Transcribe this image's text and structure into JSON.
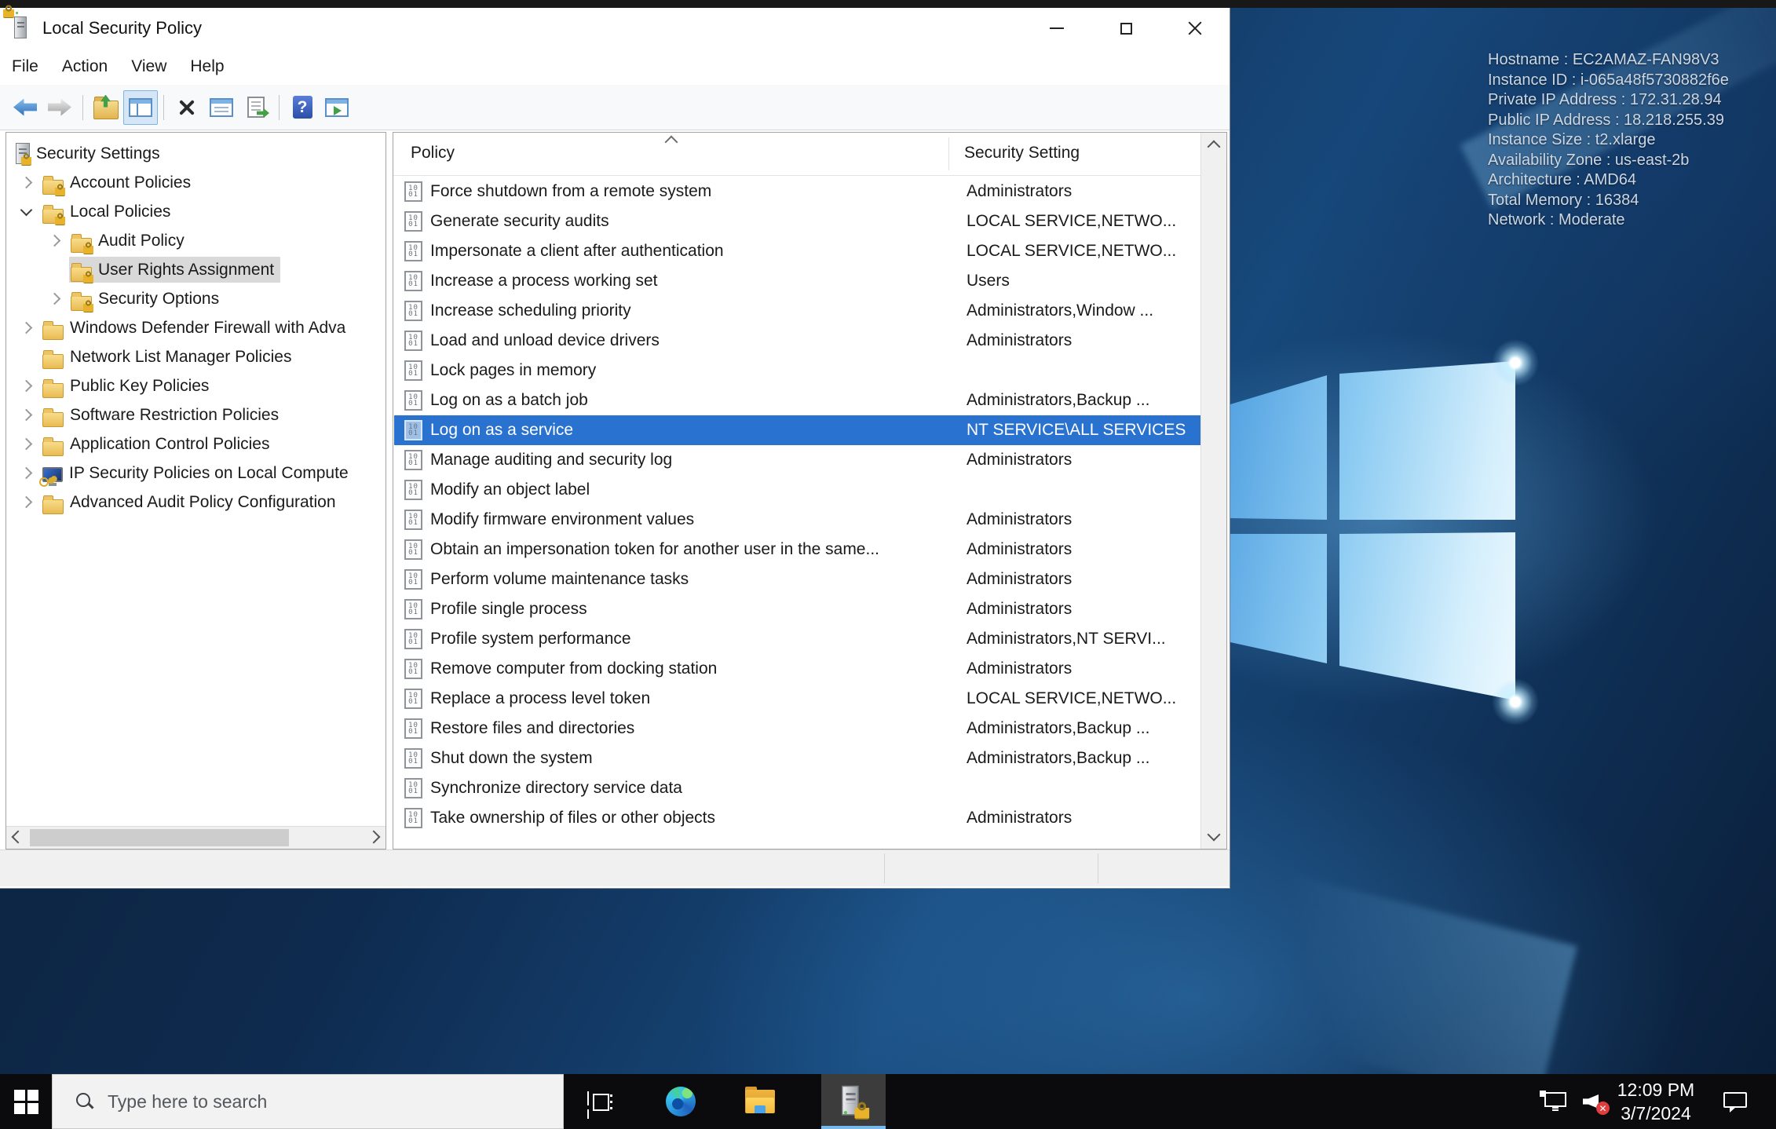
{
  "desktop": {
    "system_info": [
      "Hostname : EC2AMAZ-FAN98V3",
      "Instance ID : i-065a48f5730882f6e",
      "Private IP Address : 172.31.28.94",
      "Public IP Address : 18.218.255.39",
      "Instance Size : t2.xlarge",
      "Availability Zone : us-east-2b",
      "Architecture : AMD64",
      "Total Memory : 16384",
      "Network : Moderate"
    ]
  },
  "window": {
    "title": "Local Security Policy",
    "menu": [
      "File",
      "Action",
      "View",
      "Help"
    ],
    "toolbar_icons": [
      "back-arrow",
      "forward-arrow",
      "up-one-level",
      "show-console-tree",
      "delete",
      "properties",
      "export-list",
      "help",
      "show-action-pane"
    ],
    "tree": {
      "items": [
        {
          "label": "Security Settings",
          "level": 0,
          "expander": "none",
          "icon": "server-lock",
          "selected": false
        },
        {
          "label": "Account Policies",
          "level": 1,
          "expander": "collapsed",
          "icon": "folder-lock",
          "selected": false
        },
        {
          "label": "Local Policies",
          "level": 1,
          "expander": "expanded",
          "icon": "folder-lock",
          "selected": false
        },
        {
          "label": "Audit Policy",
          "level": 2,
          "expander": "collapsed",
          "icon": "folder-lock",
          "selected": false
        },
        {
          "label": "User Rights Assignment",
          "level": 2,
          "expander": "none",
          "icon": "folder-lock",
          "selected": true
        },
        {
          "label": "Security Options",
          "level": 2,
          "expander": "collapsed",
          "icon": "folder-lock",
          "selected": false
        },
        {
          "label": "Windows Defender Firewall with Adva",
          "level": 1,
          "expander": "collapsed",
          "icon": "folder",
          "selected": false
        },
        {
          "label": "Network List Manager Policies",
          "level": 1,
          "expander": "none",
          "icon": "folder",
          "selected": false
        },
        {
          "label": "Public Key Policies",
          "level": 1,
          "expander": "collapsed",
          "icon": "folder",
          "selected": false
        },
        {
          "label": "Software Restriction Policies",
          "level": 1,
          "expander": "collapsed",
          "icon": "folder",
          "selected": false
        },
        {
          "label": "Application Control Policies",
          "level": 1,
          "expander": "collapsed",
          "icon": "folder",
          "selected": false
        },
        {
          "label": "IP Security Policies on Local Compute",
          "level": 1,
          "expander": "collapsed",
          "icon": "computer-key",
          "selected": false
        },
        {
          "label": "Advanced Audit Policy Configuration",
          "level": 1,
          "expander": "collapsed",
          "icon": "folder",
          "selected": false
        }
      ]
    },
    "list": {
      "columns": [
        "Policy",
        "Security Setting"
      ],
      "rows": [
        {
          "policy": "Force shutdown from a remote system",
          "setting": "Administrators",
          "selected": false
        },
        {
          "policy": "Generate security audits",
          "setting": "LOCAL SERVICE,NETWO...",
          "selected": false
        },
        {
          "policy": "Impersonate a client after authentication",
          "setting": "LOCAL SERVICE,NETWO...",
          "selected": false
        },
        {
          "policy": "Increase a process working set",
          "setting": "Users",
          "selected": false
        },
        {
          "policy": "Increase scheduling priority",
          "setting": "Administrators,Window ...",
          "selected": false
        },
        {
          "policy": "Load and unload device drivers",
          "setting": "Administrators",
          "selected": false
        },
        {
          "policy": "Lock pages in memory",
          "setting": "",
          "selected": false
        },
        {
          "policy": "Log on as a batch job",
          "setting": "Administrators,Backup ...",
          "selected": false
        },
        {
          "policy": "Log on as a service",
          "setting": "NT SERVICE\\ALL SERVICES",
          "selected": true
        },
        {
          "policy": "Manage auditing and security log",
          "setting": "Administrators",
          "selected": false
        },
        {
          "policy": "Modify an object label",
          "setting": "",
          "selected": false
        },
        {
          "policy": "Modify firmware environment values",
          "setting": "Administrators",
          "selected": false
        },
        {
          "policy": "Obtain an impersonation token for another user in the same...",
          "setting": "Administrators",
          "selected": false
        },
        {
          "policy": "Perform volume maintenance tasks",
          "setting": "Administrators",
          "selected": false
        },
        {
          "policy": "Profile single process",
          "setting": "Administrators",
          "selected": false
        },
        {
          "policy": "Profile system performance",
          "setting": "Administrators,NT SERVI...",
          "selected": false
        },
        {
          "policy": "Remove computer from docking station",
          "setting": "Administrators",
          "selected": false
        },
        {
          "policy": "Replace a process level token",
          "setting": "LOCAL SERVICE,NETWO...",
          "selected": false
        },
        {
          "policy": "Restore files and directories",
          "setting": "Administrators,Backup ...",
          "selected": false
        },
        {
          "policy": "Shut down the system",
          "setting": "Administrators,Backup ...",
          "selected": false
        },
        {
          "policy": "Synchronize directory service data",
          "setting": "",
          "selected": false
        },
        {
          "policy": "Take ownership of files or other objects",
          "setting": "Administrators",
          "selected": false
        }
      ]
    }
  },
  "taskbar": {
    "search_placeholder": "Type here to search",
    "icons": [
      "start",
      "task-view",
      "edge",
      "file-explorer",
      "local-security-policy"
    ],
    "tray_icons": [
      "network",
      "volume-muted",
      "action-center"
    ],
    "clock": {
      "time": "12:09 PM",
      "date": "3/7/2024"
    }
  },
  "colors": {
    "list_selection": "#2a72cf",
    "tree_selection": "#d9d9d9",
    "taskbar_underline": "#76b9ed",
    "wallpaper_navy": "#0e2a4e"
  }
}
